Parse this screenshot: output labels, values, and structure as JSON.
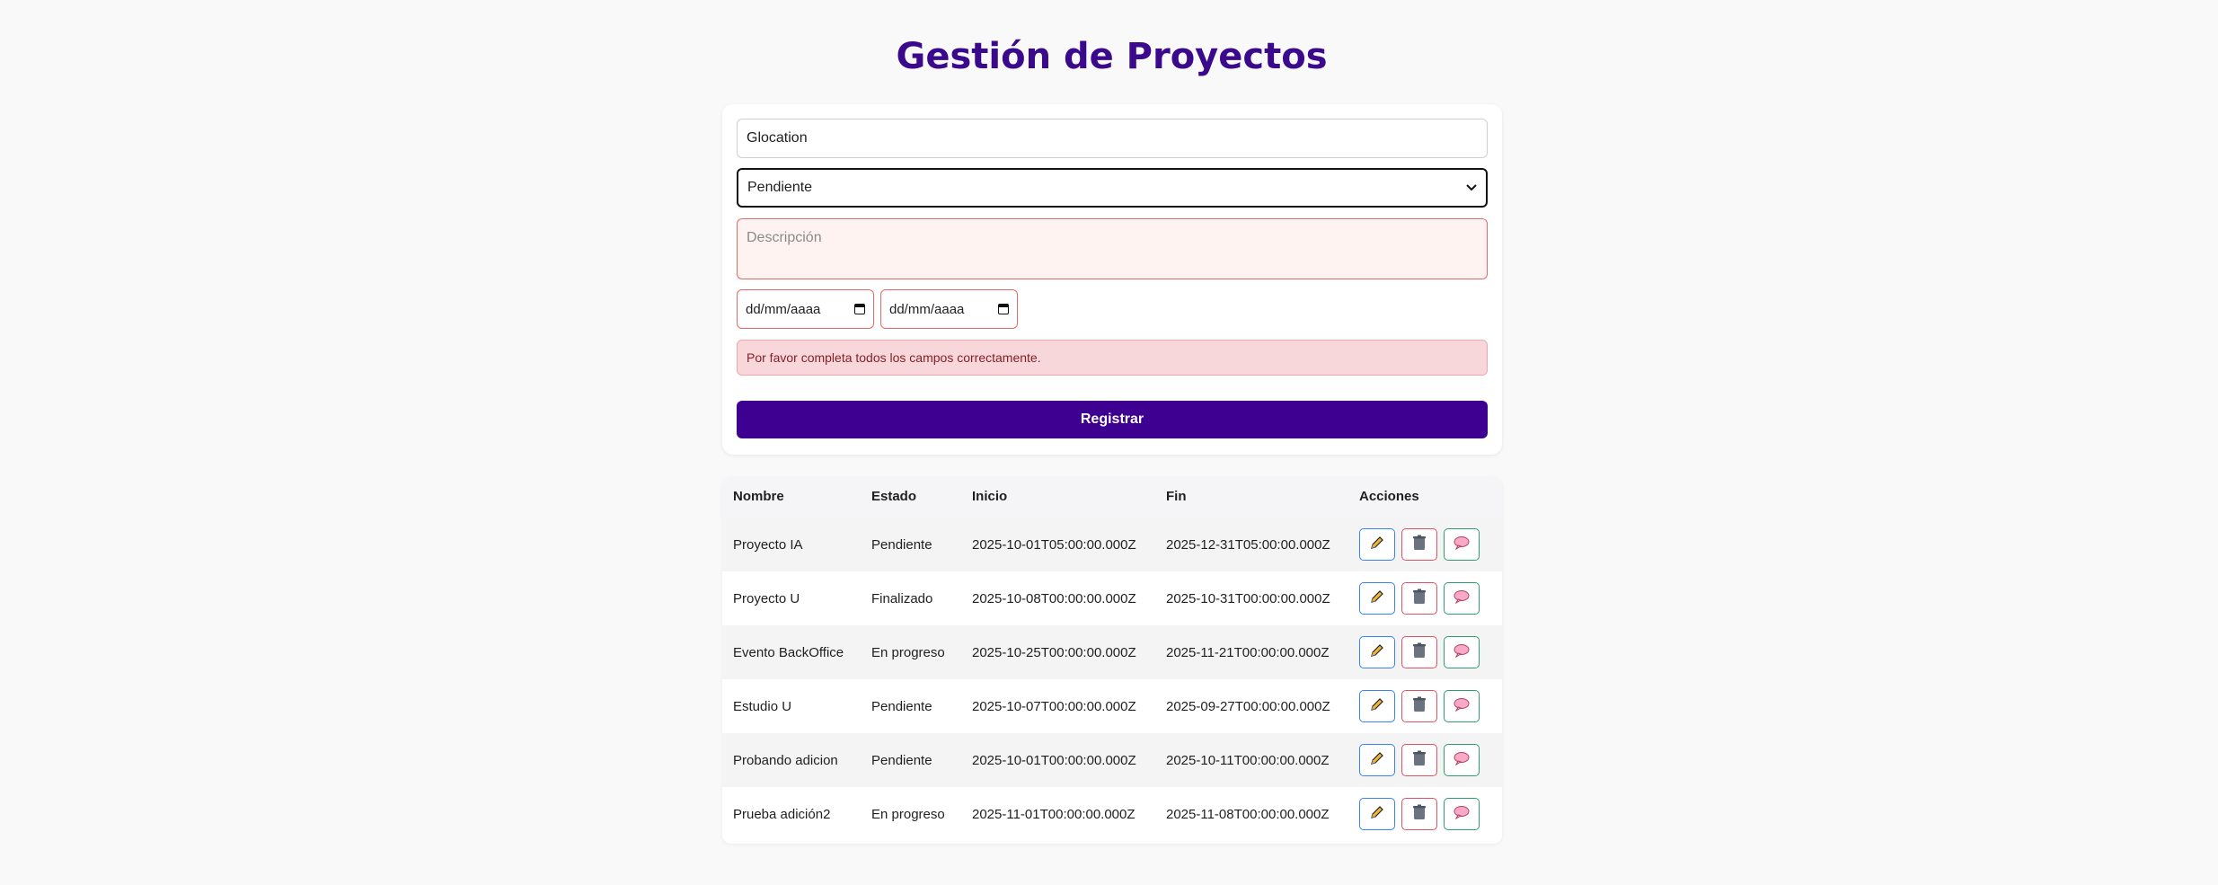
{
  "header": {
    "title": "Gestión de Proyectos"
  },
  "form": {
    "name_value": "Glocation",
    "status_selected": "Pendiente",
    "description_placeholder": "Descripción",
    "start_date_placeholder": "dd/mm/aaaa",
    "end_date_placeholder": "dd/mm/aaaa",
    "error_message": "Por favor completa todos los campos correctamente.",
    "submit_label": "Registrar"
  },
  "table": {
    "headers": {
      "name": "Nombre",
      "status": "Estado",
      "start": "Inicio",
      "end": "Fin",
      "actions": "Acciones"
    },
    "rows": [
      {
        "name": "Proyecto IA",
        "status": "Pendiente",
        "start": "2025-10-01T05:00:00.000Z",
        "end": "2025-12-31T05:00:00.000Z"
      },
      {
        "name": "Proyecto U",
        "status": "Finalizado",
        "start": "2025-10-08T00:00:00.000Z",
        "end": "2025-10-31T00:00:00.000Z"
      },
      {
        "name": "Evento BackOffice",
        "status": "En progreso",
        "start": "2025-10-25T00:00:00.000Z",
        "end": "2025-11-21T00:00:00.000Z"
      },
      {
        "name": "Estudio U",
        "status": "Pendiente",
        "start": "2025-10-07T00:00:00.000Z",
        "end": "2025-09-27T00:00:00.000Z"
      },
      {
        "name": "Probando adicion",
        "status": "Pendiente",
        "start": "2025-10-01T00:00:00.000Z",
        "end": "2025-10-11T00:00:00.000Z"
      },
      {
        "name": "Prueba adición2",
        "status": "En progreso",
        "start": "2025-11-01T00:00:00.000Z",
        "end": "2025-11-08T00:00:00.000Z"
      }
    ]
  },
  "icons": {
    "edit": "pencil-icon",
    "delete": "trash-icon",
    "comment": "speech-bubble-icon"
  },
  "colors": {
    "brand": "#3d0090",
    "title": "#3b0a8c",
    "error_bg": "#f8d7da",
    "error_text": "#842029"
  }
}
